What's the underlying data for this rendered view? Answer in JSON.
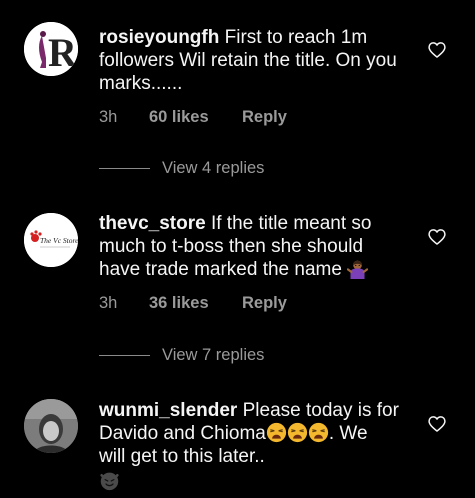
{
  "comments": [
    {
      "username": "rosieyoungfh",
      "text": "First to reach 1m followers Wil retain the title. On you marks......",
      "time": "3h",
      "likes": "60 likes",
      "reply": "Reply",
      "view_replies": "View 4 replies",
      "avatar_letter": "R"
    },
    {
      "username": "thevc_store",
      "text": "If the title meant so much to t-boss then she should have trade marked the name",
      "time": "3h",
      "likes": "36 likes",
      "reply": "Reply",
      "view_replies": "View 7 replies",
      "avatar_logo_text": "The Vc Store",
      "emoji": "person-shrugging-emoji"
    },
    {
      "username": "wunmi_slender",
      "text": "Please today is for Davido and Chioma",
      "text_after": ". We will get to this later..",
      "emoji": "weary-face-emoji",
      "emoji_trailing": "smirking-devil-face-emoji"
    }
  ],
  "colors": {
    "background": "#000000",
    "text": "#f5f5f5",
    "muted": "#9a9a9a",
    "emoji_yellow": "#f4b82e"
  },
  "icons": {
    "like": "heart-outline-icon"
  }
}
